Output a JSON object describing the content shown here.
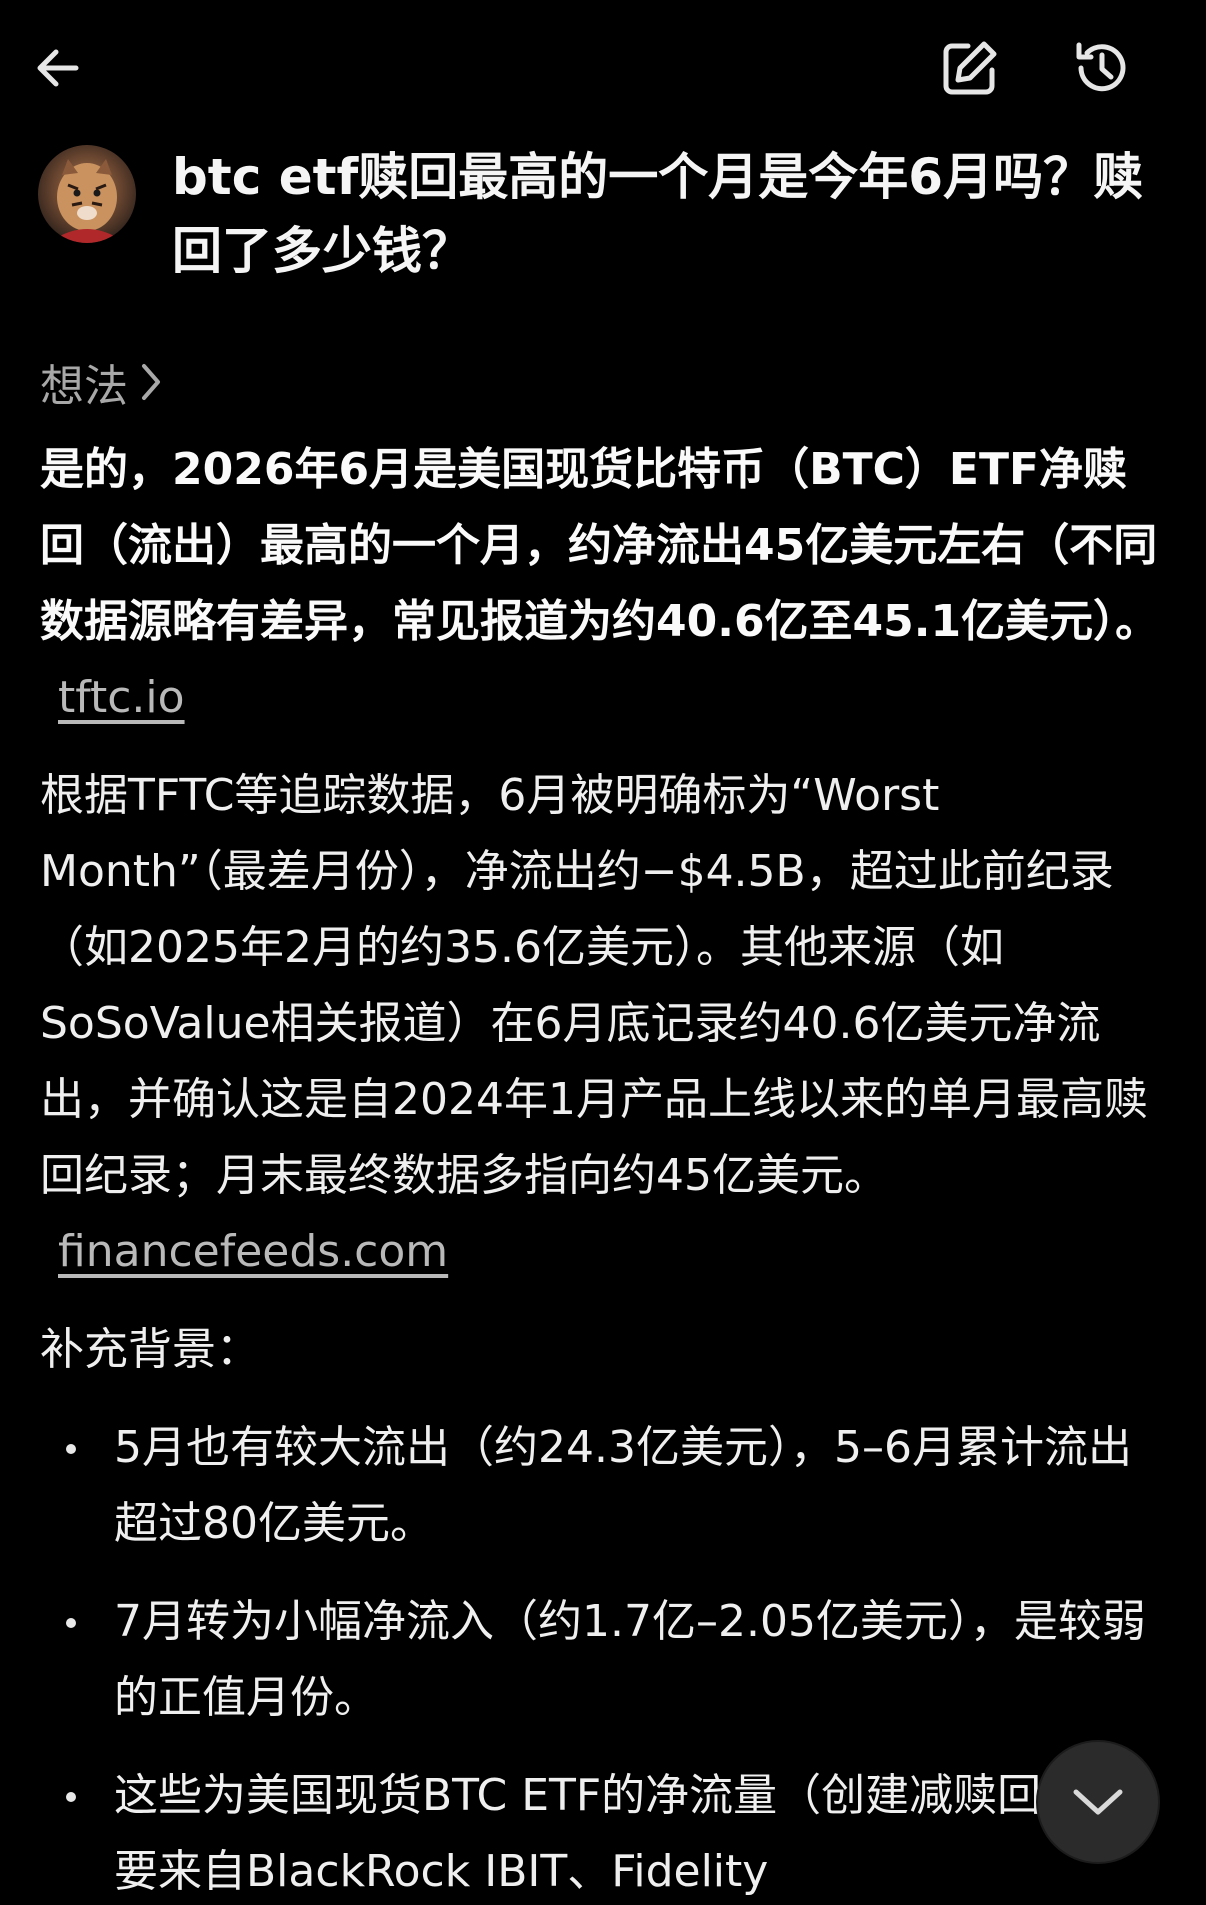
{
  "header": {
    "back_icon": "arrow-left-icon",
    "edit_icon": "edit-square-icon",
    "history_icon": "history-clock-icon"
  },
  "user_message": {
    "avatar": "tiger-avatar",
    "text": "btc etf赎回最高的一个月是今年6月吗？赎回了多少钱？"
  },
  "thinking": {
    "label": "想法",
    "icon": "chevron-right-icon"
  },
  "answer": {
    "p1_text": "是的，2026年6月是美国现货比特币（BTC）ETF净赎回（流出）最高的一个月，约净流出45亿美元左右（不同数据源略有差异，常见报道为约40.6亿至45.1亿美元）。",
    "p1_source": "tftc.io",
    "p2_text": "根据TFTC等追踪数据，6月被明确标为“Worst Month”（最差月份），净流出约−$4.5B，超过此前纪录（如2025年2月的约35.6亿美元）。其他来源（如SoSoValue相关报道）在6月底记录约40.6亿美元净流出，并确认这是自2024年1月产品上线以来的单月最高赎回纪录；月末最终数据多指向约45亿美元。",
    "p2_source": "financefeeds.com",
    "p3_heading": "补充背景：",
    "bullets": [
      "5月也有较大流出（约24.3亿美元），5–6月累计流出超过80亿美元。",
      "7月转为小幅净流入（约1.7亿–2.05亿美元），是较弱的正值月份。",
      "这些为美国现货BTC ETF的净流量（创建减赎回），主要来自BlackRock IBIT、Fidelity"
    ]
  },
  "scroll_button": {
    "icon": "chevron-down-icon"
  }
}
